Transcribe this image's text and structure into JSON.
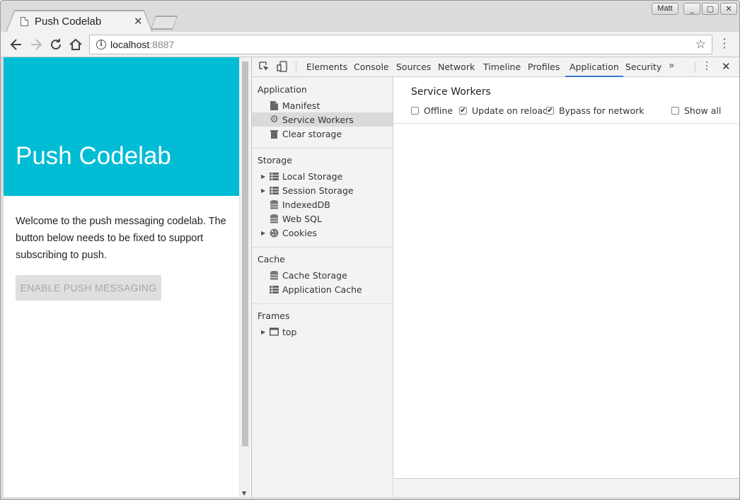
{
  "browser": {
    "tab_title": "Push Codelab",
    "profile_name": "Matt",
    "url_host": "localhost",
    "url_port": ":8887"
  },
  "page": {
    "hero_title": "Push Codelab",
    "intro_text": "Welcome to the push messaging codelab. The button below needs to be fixed to support subscribing to push.",
    "push_button_label": "ENABLE PUSH MESSAGING",
    "accent_color": "#00bcd4"
  },
  "devtools": {
    "tabs": [
      "Elements",
      "Console",
      "Sources",
      "Network",
      "Timeline",
      "Profiles",
      "Application",
      "Security"
    ],
    "active_tab": "Application",
    "sidebar": {
      "application": {
        "title": "Application",
        "items": [
          "Manifest",
          "Service Workers",
          "Clear storage"
        ]
      },
      "storage": {
        "title": "Storage",
        "items": [
          "Local Storage",
          "Session Storage",
          "IndexedDB",
          "Web SQL",
          "Cookies"
        ]
      },
      "cache": {
        "title": "Cache",
        "items": [
          "Cache Storage",
          "Application Cache"
        ]
      },
      "frames": {
        "title": "Frames",
        "items": [
          "top"
        ]
      },
      "selected_item": "Service Workers"
    },
    "service_workers": {
      "title": "Service Workers",
      "offline_label": "Offline",
      "offline_checked": false,
      "update_on_reload_label": "Update on reload",
      "update_on_reload_checked": true,
      "bypass_label": "Bypass for network",
      "bypass_checked": true,
      "show_all_label": "Show all",
      "show_all_checked": false
    }
  }
}
